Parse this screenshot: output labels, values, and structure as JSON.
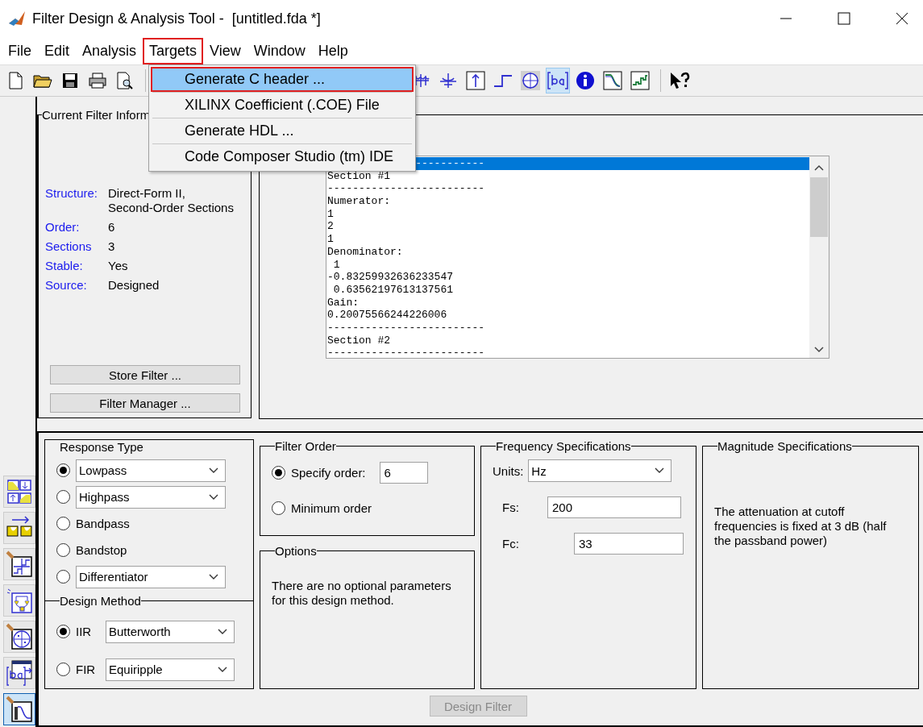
{
  "window": {
    "title": "Filter Design & Analysis Tool -  [untitled.fda *]"
  },
  "menu": [
    {
      "label": "File",
      "selected": false
    },
    {
      "label": "Edit",
      "selected": false
    },
    {
      "label": "Analysis",
      "selected": false
    },
    {
      "label": "Targets",
      "selected": true
    },
    {
      "label": "View",
      "selected": false
    },
    {
      "label": "Window",
      "selected": false
    },
    {
      "label": "Help",
      "selected": false
    }
  ],
  "dropdown": [
    {
      "label": "Generate C header ...",
      "selected": true
    },
    {
      "label": "XILINX Coefficient (.COE) File",
      "selected": false
    },
    {
      "label": "Generate HDL ...",
      "selected": false
    },
    {
      "label": "Code Composer Studio (tm) IDE",
      "selected": false
    }
  ],
  "toolbar": [
    {
      "items": [
        {
          "kind": "new",
          "on": false
        },
        {
          "kind": "open",
          "on": false
        },
        {
          "kind": "save",
          "on": false
        },
        {
          "kind": "print",
          "on": false
        },
        {
          "kind": "preview",
          "on": false
        }
      ]
    },
    {
      "items": [
        {
          "kind": "group-delay",
          "on": false
        },
        {
          "kind": "phase-delay",
          "on": false
        },
        {
          "kind": "impulse",
          "on": false
        },
        {
          "kind": "step",
          "on": false
        },
        {
          "kind": "pole-zero",
          "on": false
        },
        {
          "kind": "coefficients",
          "on": true
        },
        {
          "kind": "info",
          "on": false
        },
        {
          "kind": "magnitude",
          "on": false
        },
        {
          "kind": "round-off",
          "on": false
        }
      ]
    },
    {
      "items": [
        {
          "kind": "help",
          "on": false
        }
      ]
    }
  ],
  "side_tools": [
    {
      "kind": "transform",
      "selected": false
    },
    {
      "kind": "convert",
      "selected": false
    },
    {
      "kind": "quantize",
      "selected": false
    },
    {
      "kind": "realize",
      "selected": false
    },
    {
      "kind": "pole-zero",
      "selected": false
    },
    {
      "kind": "import",
      "selected": false
    },
    {
      "kind": "design",
      "selected": true
    }
  ],
  "filter_info": {
    "title": "Current Filter Inform",
    "fields": [
      {
        "label": "Structure:",
        "value": "Direct-Form II,\nSecond-Order Sections"
      },
      {
        "label": "Order:",
        "value": "6"
      },
      {
        "label": "Sections",
        "value": "3"
      },
      {
        "label": "Stable:",
        "value": "Yes"
      },
      {
        "label": "Source:",
        "value": "Designed"
      }
    ],
    "buttons": [
      "Store Filter ...",
      "Filter Manager ..."
    ]
  },
  "coefficients": {
    "lines": [
      {
        "text": "              -----------",
        "selected": true
      },
      {
        "text": "Section #1",
        "selected": false
      },
      {
        "text": "-------------------------",
        "selected": false
      },
      {
        "text": "Numerator:",
        "selected": false
      },
      {
        "text": "1",
        "selected": false
      },
      {
        "text": "2",
        "selected": false
      },
      {
        "text": "1",
        "selected": false
      },
      {
        "text": "Denominator:",
        "selected": false
      },
      {
        "text": " 1",
        "selected": false
      },
      {
        "text": "-0.83259932636233547",
        "selected": false
      },
      {
        "text": " 0.63562197613137561",
        "selected": false
      },
      {
        "text": "Gain:",
        "selected": false
      },
      {
        "text": "0.20075566244226006",
        "selected": false
      },
      {
        "text": "-------------------------",
        "selected": false
      },
      {
        "text": "Section #2",
        "selected": false
      },
      {
        "text": "-------------------------",
        "selected": false
      }
    ]
  },
  "response_type": {
    "title": "Response Type",
    "options": [
      {
        "label": "Lowpass",
        "selected": true,
        "kind": "dropdown"
      },
      {
        "label": "Highpass",
        "selected": false,
        "kind": "dropdown"
      },
      {
        "label": "Bandpass",
        "selected": false,
        "kind": "plain"
      },
      {
        "label": "Bandstop",
        "selected": false,
        "kind": "plain"
      },
      {
        "label": "Differentiator",
        "selected": false,
        "kind": "dropdown"
      }
    ]
  },
  "design_method": {
    "title": "Design Method",
    "options": [
      {
        "label": "IIR",
        "selected": true,
        "value": "Butterworth"
      },
      {
        "label": "FIR",
        "selected": false,
        "value": "Equiripple"
      }
    ]
  },
  "filter_order": {
    "title": "Filter Order",
    "options": [
      {
        "label": "Specify order:",
        "selected": true,
        "value": "6"
      },
      {
        "label": "Minimum order",
        "selected": false
      }
    ]
  },
  "options": {
    "title": "Options",
    "text": "There are no optional parameters for this design method."
  },
  "frequency": {
    "title": "Frequency Specifications",
    "units_label": "Units:",
    "units": "Hz",
    "fields": [
      {
        "label": "Fs:",
        "value": "200"
      },
      {
        "label": "Fc:",
        "value": "33"
      }
    ]
  },
  "magnitude": {
    "title": "Magnitude Specifications",
    "text": "The attenuation at cutoff frequencies is fixed at 3 dB (half the passband power)"
  },
  "design_button": {
    "label": "Design Filter",
    "disabled": true
  }
}
